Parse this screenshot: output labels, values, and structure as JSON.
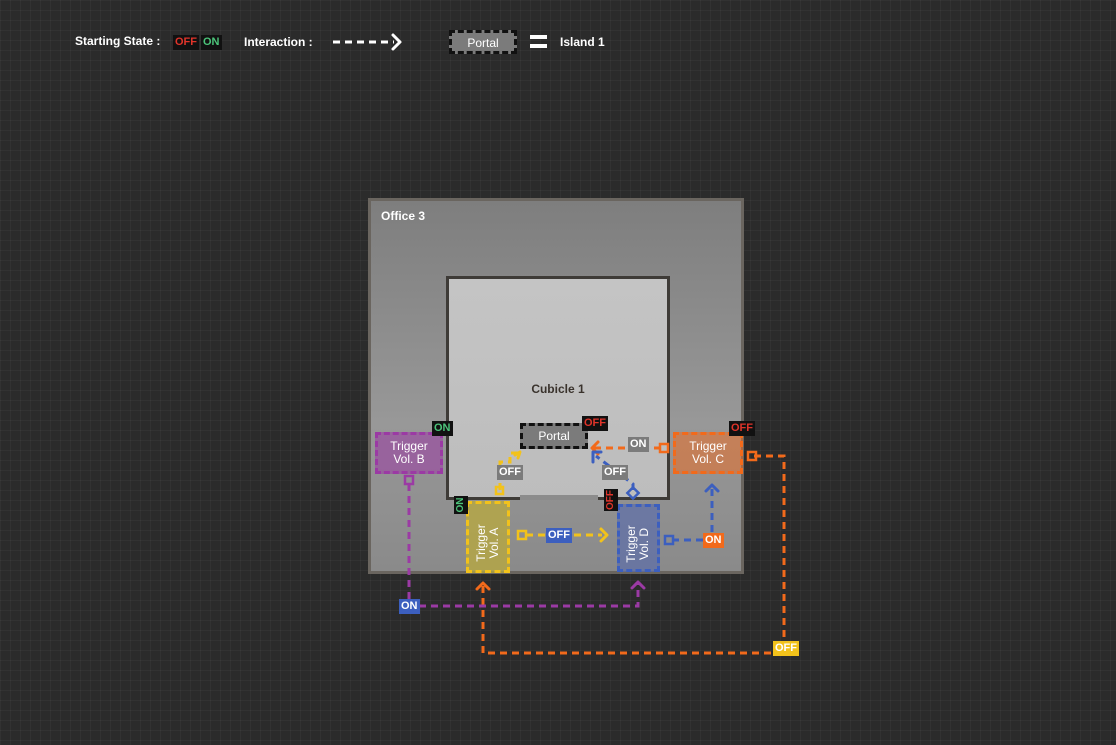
{
  "legend": {
    "starting_state_label": "Starting State :",
    "off_tag": "OFF",
    "on_tag": "ON",
    "interaction_label": "Interaction :",
    "portal_label": "Portal",
    "island_label": "Island 1"
  },
  "office": {
    "title": "Office 3"
  },
  "cubicle": {
    "title": "Cubicle 1"
  },
  "portal": {
    "label": "Portal",
    "state": "OFF"
  },
  "volumes": {
    "a": {
      "line1": "Trigger",
      "line2": "Vol. A",
      "state": "ON"
    },
    "b": {
      "line1": "Trigger",
      "line2": "Vol. B",
      "state": "ON"
    },
    "c": {
      "line1": "Trigger",
      "line2": "Vol. C",
      "state": "OFF"
    },
    "d": {
      "line1": "Trigger",
      "line2": "Vol. D",
      "state": "OFF"
    }
  },
  "interactions": {
    "a_to_portal": "OFF",
    "a_to_d": "OFF",
    "d_to_portal": "OFF",
    "c_to_portal": "ON",
    "d_to_c": "ON",
    "b_to_a_d": "ON",
    "c_to_a": "OFF"
  },
  "colors": {
    "background": "#2b2b2b",
    "vol_a": "#f2c21b",
    "vol_b": "#9b3aa4",
    "vol_c": "#f26a1b",
    "vol_d": "#3c5fbf",
    "off_red": "#e0342a",
    "on_green": "#4cc47a"
  }
}
